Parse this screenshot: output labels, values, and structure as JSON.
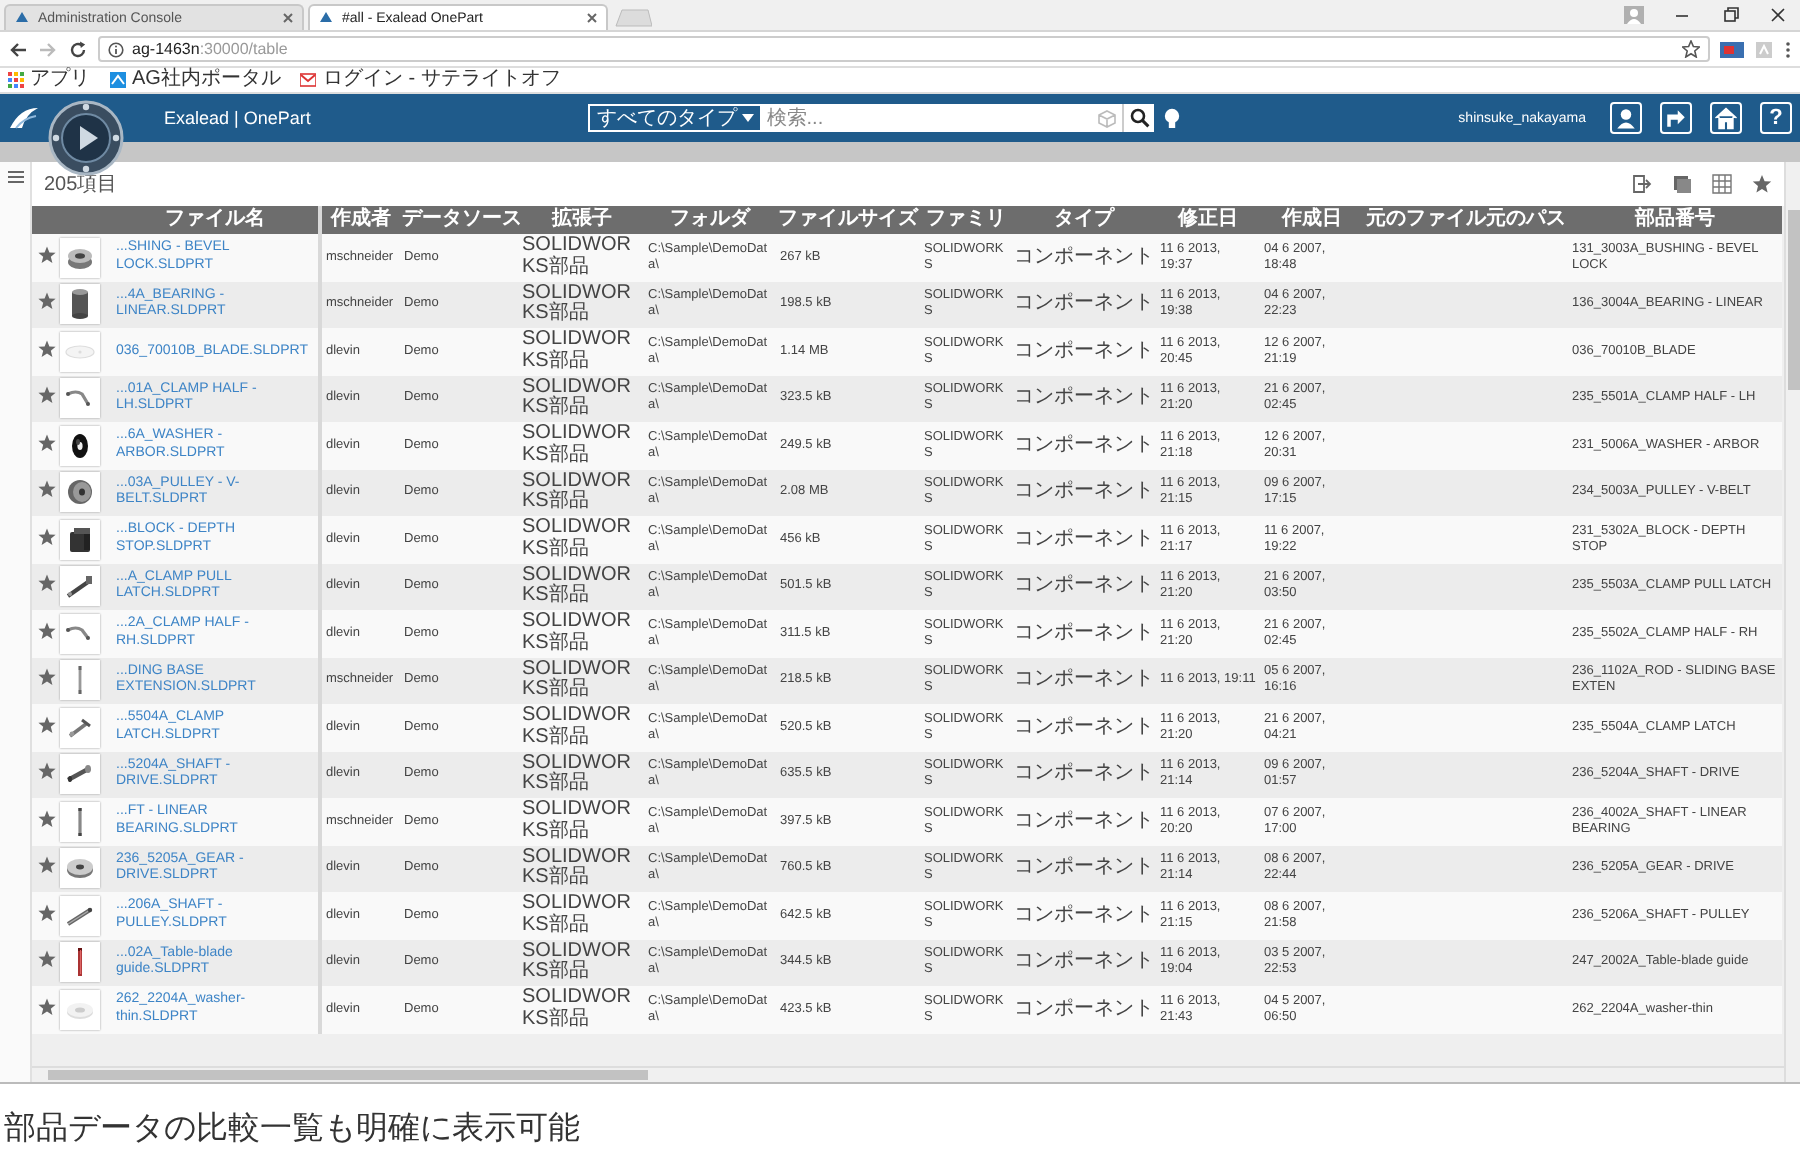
{
  "browser": {
    "tabs": [
      {
        "title": "Administration Console",
        "selected": false
      },
      {
        "title": "#all - Exalead OnePart",
        "selected": true
      }
    ],
    "url_host": "ag-1463n",
    "url_path": ":30000/table",
    "bookmarks": [
      {
        "label": "アプリ"
      },
      {
        "label": "AG社内ポータル"
      },
      {
        "label": "ログイン - サテライトオフ"
      }
    ]
  },
  "app": {
    "brand": "Exalead | OnePart",
    "type_filter": "すべてのタイプ",
    "search": {
      "placeholder": "検索..."
    },
    "user": "shinsuke_nakayama",
    "help": "?"
  },
  "results": {
    "count": "205項目"
  },
  "table": {
    "columns": [
      {
        "label": "ファイル名"
      },
      {
        "label": "作成者"
      },
      {
        "label": "データソース"
      },
      {
        "label": "拡張子"
      },
      {
        "label": "フォルダ"
      },
      {
        "label": "ファイルサイズ"
      },
      {
        "label": "ファミリ"
      },
      {
        "label": "タイプ"
      },
      {
        "label": "修正日"
      },
      {
        "label": "作成日"
      },
      {
        "label": "元のファイル"
      },
      {
        "label": "元のパス"
      },
      {
        "label": "部品番号"
      }
    ],
    "rows": [
      {
        "file_name": "...SHING - BEVEL LOCK.SLDPRT",
        "author": "mschneider",
        "data_source": "Demo",
        "extension": "SOLIDWORKS部品",
        "folder": "C:\\Sample\\DemoData\\",
        "file_size": "267 kB",
        "family": "SOLIDWORKS",
        "type": "コンポーネント",
        "modified": "11 6 2013, 19:37",
        "created": "04 6 2007, 18:48",
        "part_number": "131_3003A_BUSHING - BEVEL LOCK"
      },
      {
        "file_name": "...4A_BEARING - LINEAR.SLDPRT",
        "author": "mschneider",
        "data_source": "Demo",
        "extension": "SOLIDWORKS部品",
        "folder": "C:\\Sample\\DemoData\\",
        "file_size": "198.5 kB",
        "family": "SOLIDWORKS",
        "type": "コンポーネント",
        "modified": "11 6 2013, 19:38",
        "created": "04 6 2007, 22:23",
        "part_number": "136_3004A_BEARING - LINEAR"
      },
      {
        "file_name": "036_70010B_BLADE.SLDPRT",
        "author": "dlevin",
        "data_source": "Demo",
        "extension": "SOLIDWORKS部品",
        "folder": "C:\\Sample\\DemoData\\",
        "file_size": "1.14 MB",
        "family": "SOLIDWORKS",
        "type": "コンポーネント",
        "modified": "11 6 2013, 20:45",
        "created": "12 6 2007, 21:19",
        "part_number": "036_70010B_BLADE"
      },
      {
        "file_name": "...01A_CLAMP HALF - LH.SLDPRT",
        "author": "dlevin",
        "data_source": "Demo",
        "extension": "SOLIDWORKS部品",
        "folder": "C:\\Sample\\DemoData\\",
        "file_size": "323.5 kB",
        "family": "SOLIDWORKS",
        "type": "コンポーネント",
        "modified": "11 6 2013, 21:20",
        "created": "21 6 2007, 02:45",
        "part_number": "235_5501A_CLAMP HALF - LH"
      },
      {
        "file_name": "...6A_WASHER - ARBOR.SLDPRT",
        "author": "dlevin",
        "data_source": "Demo",
        "extension": "SOLIDWORKS部品",
        "folder": "C:\\Sample\\DemoData\\",
        "file_size": "249.5 kB",
        "family": "SOLIDWORKS",
        "type": "コンポーネント",
        "modified": "11 6 2013, 21:18",
        "created": "12 6 2007, 20:31",
        "part_number": "231_5006A_WASHER - ARBOR"
      },
      {
        "file_name": "...03A_PULLEY - V-BELT.SLDPRT",
        "author": "dlevin",
        "data_source": "Demo",
        "extension": "SOLIDWORKS部品",
        "folder": "C:\\Sample\\DemoData\\",
        "file_size": "2.08 MB",
        "family": "SOLIDWORKS",
        "type": "コンポーネント",
        "modified": "11 6 2013, 21:15",
        "created": "09 6 2007, 17:15",
        "part_number": "234_5003A_PULLEY - V-BELT"
      },
      {
        "file_name": "...BLOCK - DEPTH STOP.SLDPRT",
        "author": "dlevin",
        "data_source": "Demo",
        "extension": "SOLIDWORKS部品",
        "folder": "C:\\Sample\\DemoData\\",
        "file_size": "456 kB",
        "family": "SOLIDWORKS",
        "type": "コンポーネント",
        "modified": "11 6 2013, 21:17",
        "created": "11 6 2007, 19:22",
        "part_number": "231_5302A_BLOCK - DEPTH STOP"
      },
      {
        "file_name": "...A_CLAMP PULL LATCH.SLDPRT",
        "author": "dlevin",
        "data_source": "Demo",
        "extension": "SOLIDWORKS部品",
        "folder": "C:\\Sample\\DemoData\\",
        "file_size": "501.5 kB",
        "family": "SOLIDWORKS",
        "type": "コンポーネント",
        "modified": "11 6 2013, 21:20",
        "created": "21 6 2007, 03:50",
        "part_number": "235_5503A_CLAMP PULL LATCH"
      },
      {
        "file_name": "...2A_CLAMP HALF - RH.SLDPRT",
        "author": "dlevin",
        "data_source": "Demo",
        "extension": "SOLIDWORKS部品",
        "folder": "C:\\Sample\\DemoData\\",
        "file_size": "311.5 kB",
        "family": "SOLIDWORKS",
        "type": "コンポーネント",
        "modified": "11 6 2013, 21:20",
        "created": "21 6 2007, 02:45",
        "part_number": "235_5502A_CLAMP HALF - RH"
      },
      {
        "file_name": "...DING BASE EXTENSION.SLDPRT",
        "author": "mschneider",
        "data_source": "Demo",
        "extension": "SOLIDWORKS部品",
        "folder": "C:\\Sample\\DemoData\\",
        "file_size": "218.5 kB",
        "family": "SOLIDWORKS",
        "type": "コンポーネント",
        "modified": "11 6 2013, 19:11",
        "created": "05 6 2007, 16:16",
        "part_number": "236_1102A_ROD - SLIDING BASE EXTEN"
      },
      {
        "file_name": "...5504A_CLAMP LATCH.SLDPRT",
        "author": "dlevin",
        "data_source": "Demo",
        "extension": "SOLIDWORKS部品",
        "folder": "C:\\Sample\\DemoData\\",
        "file_size": "520.5 kB",
        "family": "SOLIDWORKS",
        "type": "コンポーネント",
        "modified": "11 6 2013, 21:20",
        "created": "21 6 2007, 04:21",
        "part_number": "235_5504A_CLAMP LATCH"
      },
      {
        "file_name": "...5204A_SHAFT - DRIVE.SLDPRT",
        "author": "dlevin",
        "data_source": "Demo",
        "extension": "SOLIDWORKS部品",
        "folder": "C:\\Sample\\DemoData\\",
        "file_size": "635.5 kB",
        "family": "SOLIDWORKS",
        "type": "コンポーネント",
        "modified": "11 6 2013, 21:14",
        "created": "09 6 2007, 01:57",
        "part_number": "236_5204A_SHAFT - DRIVE"
      },
      {
        "file_name": "...FT - LINEAR BEARING.SLDPRT",
        "author": "mschneider",
        "data_source": "Demo",
        "extension": "SOLIDWORKS部品",
        "folder": "C:\\Sample\\DemoData\\",
        "file_size": "397.5 kB",
        "family": "SOLIDWORKS",
        "type": "コンポーネント",
        "modified": "11 6 2013, 20:20",
        "created": "07 6 2007, 17:00",
        "part_number": "236_4002A_SHAFT - LINEAR BEARING"
      },
      {
        "file_name": "236_5205A_GEAR - DRIVE.SLDPRT",
        "author": "dlevin",
        "data_source": "Demo",
        "extension": "SOLIDWORKS部品",
        "folder": "C:\\Sample\\DemoData\\",
        "file_size": "760.5 kB",
        "family": "SOLIDWORKS",
        "type": "コンポーネント",
        "modified": "11 6 2013, 21:14",
        "created": "08 6 2007, 22:44",
        "part_number": "236_5205A_GEAR - DRIVE"
      },
      {
        "file_name": "...206A_SHAFT - PULLEY.SLDPRT",
        "author": "dlevin",
        "data_source": "Demo",
        "extension": "SOLIDWORKS部品",
        "folder": "C:\\Sample\\DemoData\\",
        "file_size": "642.5 kB",
        "family": "SOLIDWORKS",
        "type": "コンポーネント",
        "modified": "11 6 2013, 21:15",
        "created": "08 6 2007, 21:58",
        "part_number": "236_5206A_SHAFT - PULLEY"
      },
      {
        "file_name": "...02A_Table-blade guide.SLDPRT",
        "author": "dlevin",
        "data_source": "Demo",
        "extension": "SOLIDWORKS部品",
        "folder": "C:\\Sample\\DemoData\\",
        "file_size": "344.5 kB",
        "family": "SOLIDWORKS",
        "type": "コンポーネント",
        "modified": "11 6 2013, 19:04",
        "created": "03 5 2007, 22:53",
        "part_number": "247_2002A_Table-blade guide"
      },
      {
        "file_name": "262_2204A_washer-thin.SLDPRT",
        "author": "dlevin",
        "data_source": "Demo",
        "extension": "SOLIDWORKS部品",
        "folder": "C:\\Sample\\DemoData\\",
        "file_size": "423.5 kB",
        "family": "SOLIDWORKS",
        "type": "コンポーネント",
        "modified": "11 6 2013, 21:43",
        "created": "04 5 2007, 06:50",
        "part_number": "262_2204A_washer-thin"
      }
    ]
  },
  "caption": "部品データの比較一覧も明確に表示可能"
}
